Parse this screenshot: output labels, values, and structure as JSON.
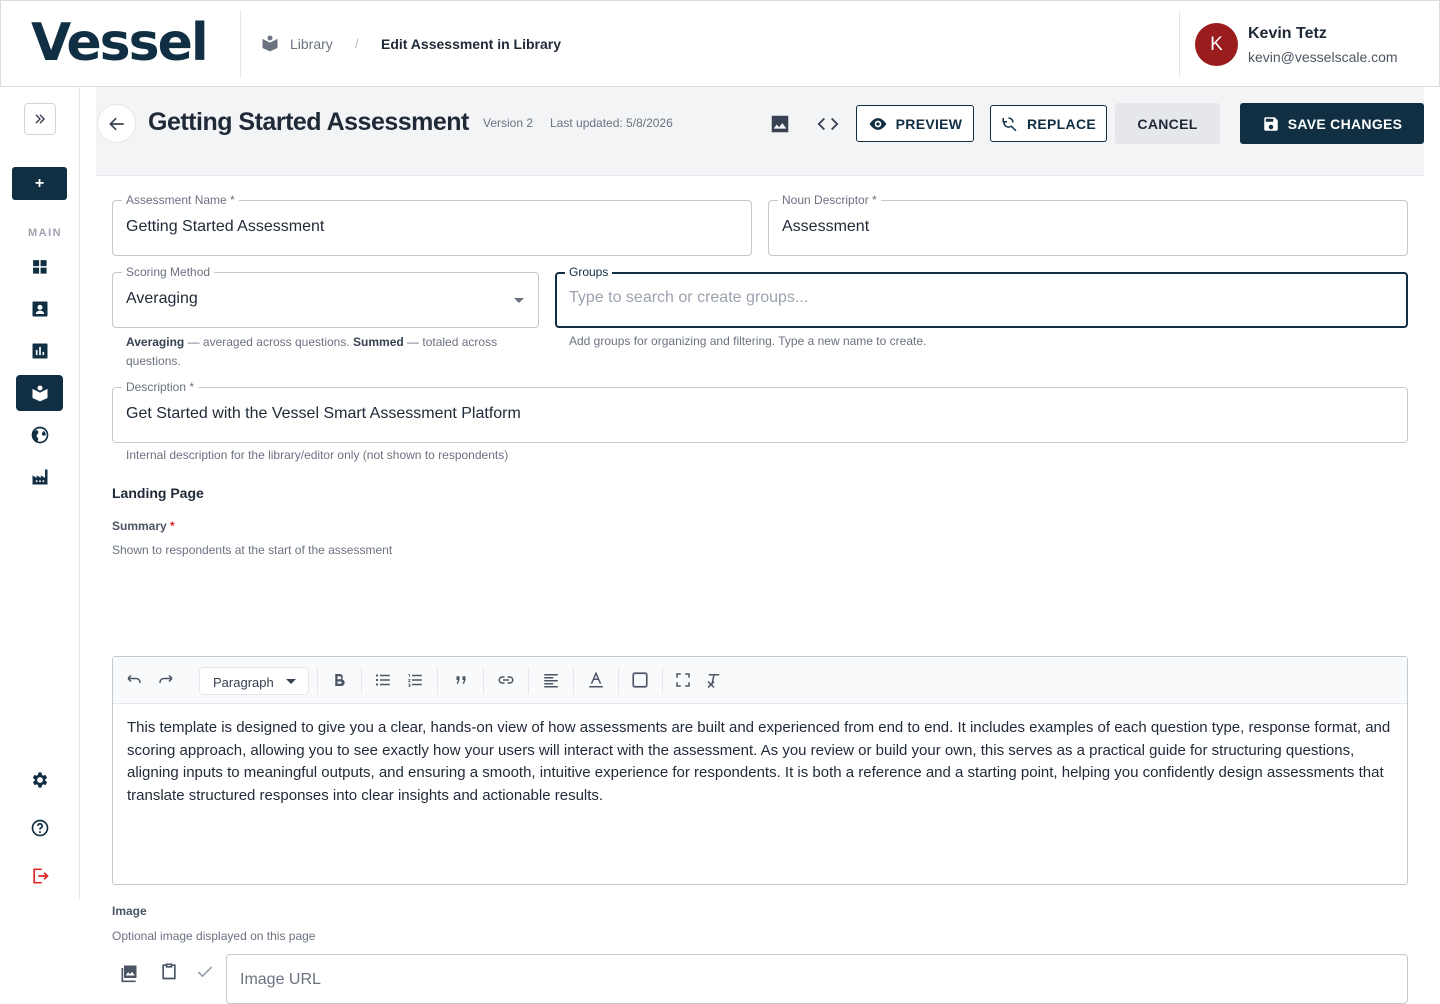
{
  "app": {
    "logo": "Vessel"
  },
  "breadcrumb": {
    "parent": "Library",
    "separator": "/",
    "current": "Edit Assessment in Library"
  },
  "user": {
    "initial": "K",
    "name": "Kevin Tetz",
    "email": "kevin@vesselscale.com",
    "avatar_color": "#9b1c1c"
  },
  "sidebar": {
    "add_label": "+",
    "section_label": "MAIN",
    "items": [
      "dashboard-icon",
      "contacts-icon",
      "analytics-icon",
      "library-icon",
      "globe-icon",
      "factory-icon"
    ],
    "active_item": "library-icon",
    "bottom_items": [
      "settings-icon",
      "help-icon",
      "logout-icon"
    ]
  },
  "header": {
    "title": "Getting Started Assessment",
    "version": "Version 2",
    "last_updated": "Last updated: 5/8/2026",
    "preview_label": "PREVIEW",
    "replace_label": "REPLACE",
    "cancel_label": "CANCEL",
    "save_label": "SAVE CHANGES"
  },
  "form": {
    "assessment_name": {
      "label": "Assessment Name *",
      "value": "Getting Started Assessment"
    },
    "noun_descriptor": {
      "label": "Noun Descriptor *",
      "value": "Assessment"
    },
    "scoring_method": {
      "label": "Scoring Method",
      "value": "Averaging",
      "help_term1": "Averaging",
      "help_text1": " — averaged across questions. ",
      "help_term2": "Summed",
      "help_text2": " — totaled across questions."
    },
    "groups": {
      "label": "Groups",
      "placeholder": "Type to search or create groups...",
      "help": "Add groups for organizing and filtering. Type a new name to create."
    },
    "description": {
      "label": "Description *",
      "value": "Get Started with the Vessel Smart Assessment Platform",
      "help": "Internal description for the library/editor only (not shown to respondents)"
    }
  },
  "landing_page": {
    "title": "Landing Page",
    "summary_label": "Summary",
    "summary_required": "*",
    "summary_help": "Shown to respondents at the start of the assessment",
    "editor": {
      "block_type": "Paragraph",
      "text": "This template is designed to give you a clear, hands-on view of how assessments are built and experienced from end to end. It includes examples of each question type, response format, and scoring approach, allowing you to see exactly how your users will interact with the assessment. As you review or build your own, this serves as a practical guide for structuring questions, aligning inputs to meaningful outputs, and ensuring a smooth, intuitive experience for respondents. It is both a reference and a starting point, helping you confidently design assessments that translate structured responses into clear insights and actionable results."
    },
    "image_label": "Image",
    "image_help": "Optional image displayed on this page",
    "image_url_placeholder": "Image URL"
  },
  "colors": {
    "primary": "#102f43",
    "danger": "#dc2626",
    "background": "#f3f4f6"
  }
}
